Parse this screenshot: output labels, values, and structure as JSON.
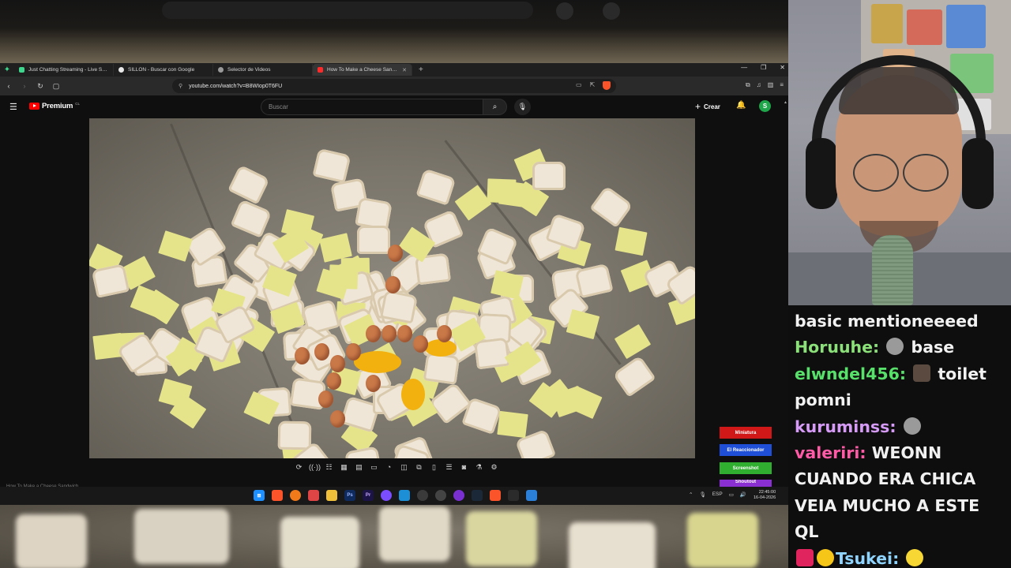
{
  "colors": {
    "accent_youtube": "#ff0000",
    "avatar": "#1fa64b",
    "user_horuuhe": "#8be07a",
    "user_elwndel456": "#57e06a",
    "user_kuruminss": "#d69bf7",
    "user_valeriri": "#ff5aa6",
    "user_tsukei": "#8fd4ff"
  },
  "browser": {
    "tabs": [
      {
        "label": "Just Chatting Streaming - Live Stream",
        "favicon": "twitch-icon",
        "color": "#3dd68c"
      },
      {
        "label": "SILLON - Buscar con Google",
        "favicon": "google-icon",
        "color": "#e8e8e8"
      },
      {
        "label": "Selector de Videos",
        "favicon": "globe-icon",
        "color": "#9a9a9a"
      },
      {
        "label": "How To Make a Cheese Sandwich",
        "favicon": "youtube-icon",
        "color": "#ff2b2b",
        "active": true
      }
    ],
    "url": "youtube.com/watch?v=B8WIop0T6FU"
  },
  "youtube": {
    "logo_text": "Premium",
    "logo_suffix": "CL",
    "search_placeholder": "Buscar",
    "create_label": "Crear",
    "avatar_letter": "S",
    "bottom_title": "How To Make a Cheese Sandwich"
  },
  "reaction_buttons": [
    {
      "label": "Miniatura",
      "color": "#d01818"
    },
    {
      "label": "El Reaccionador",
      "color": "#1e4fd6"
    },
    {
      "label": "Screenshot",
      "color": "#2fae2f"
    },
    {
      "label": "Shoutout",
      "color": "#8a2fd1"
    }
  ],
  "taskbar": {
    "language": "ESP",
    "time": "22:45:00",
    "date": "16-04-2026"
  },
  "chat": [
    {
      "user": "",
      "text": "basic mentioneeeed",
      "emote": ""
    },
    {
      "user": "Horuuhe:",
      "text": "base",
      "emote": "gray-face-emote",
      "user_color_key": "user_horuuhe"
    },
    {
      "user": "elwndel456:",
      "text": "toilet pomni",
      "emote": "portrait-emote",
      "user_color_key": "user_elwndel456"
    },
    {
      "user": "kuruminss:",
      "text": "",
      "emote": "gray-face-emote",
      "user_color_key": "user_kuruminss"
    },
    {
      "user": "valeriri:",
      "text": "WEONN CUANDO ERA CHICA VEIA MUCHO A ESTE QL",
      "emote": "",
      "user_color_key": "user_valeriri"
    },
    {
      "user": "Tsukei:",
      "text": "",
      "emote": "duck-emote",
      "user_color_key": "user_tsukei"
    }
  ]
}
